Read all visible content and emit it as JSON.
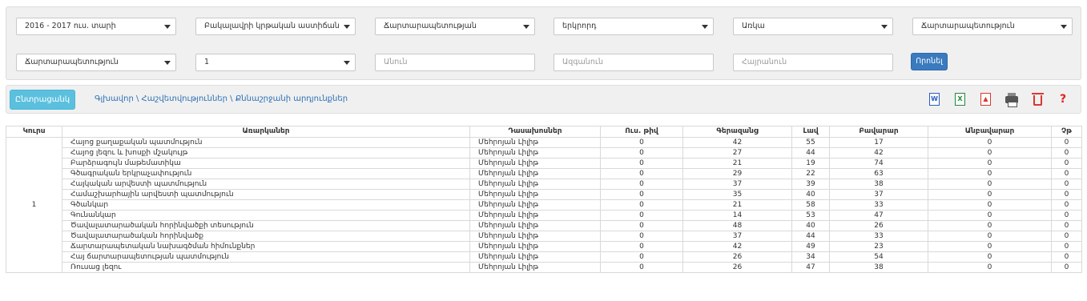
{
  "filters": {
    "row1": [
      {
        "value": "2016 - 2017 ուս. տարի",
        "type": "select"
      },
      {
        "value": "Բակալավրի կրթական աստիճան",
        "type": "select"
      },
      {
        "value": "Ճարտարապետության",
        "type": "select"
      },
      {
        "value": "երկրորդ",
        "type": "select"
      },
      {
        "value": "Առկա",
        "type": "select"
      },
      {
        "value": "Ճարտարապետություն",
        "type": "select"
      }
    ],
    "row2": [
      {
        "value": "Ճարտարապետություն",
        "type": "select"
      },
      {
        "value": "1",
        "type": "select"
      },
      {
        "placeholder": "Անուն",
        "type": "input"
      },
      {
        "placeholder": "Ազգանուն",
        "type": "input"
      },
      {
        "placeholder": "Հայրանուն",
        "type": "input"
      }
    ],
    "search_label": "Որոնել"
  },
  "toolbar": {
    "menu_label": "Ընտրացանկ",
    "breadcrumb": "Գլխավոր \\ Հաշվետվություններ \\ Քննաշրջանի արդյունքներ",
    "icons": [
      "word-icon",
      "excel-icon",
      "pdf-icon",
      "print-icon",
      "trash-icon",
      "help-icon"
    ]
  },
  "table": {
    "headers": [
      "Կուրս",
      "Առարկաներ",
      "Դասախոսներ",
      "Ուս. թիվ",
      "Գերազանց",
      "Լավ",
      "Բավարար",
      "Անբավարար",
      "Չթ"
    ],
    "course": "1",
    "rows": [
      [
        "Հայոց քաղաքական պատմություն",
        "Մեհրոյան Լիլիթ",
        "0",
        "42",
        "55",
        "17",
        "0",
        "0"
      ],
      [
        "Հայոց լեզու և խոսքի մշակույթ",
        "Մեհրոյան Լիլիթ",
        "0",
        "27",
        "44",
        "42",
        "0",
        "0"
      ],
      [
        "Բարձրագույն մաթեմատիկա",
        "Մեհրոյան Լիլիթ",
        "0",
        "21",
        "19",
        "74",
        "0",
        "0"
      ],
      [
        "Գծագրական երկրաչափություն",
        "Մեհրոյան Լիլիթ",
        "0",
        "29",
        "22",
        "63",
        "0",
        "0"
      ],
      [
        "Հայկական արվեստի պատմություն",
        "Մեհրոյան Լիլիթ",
        "0",
        "37",
        "39",
        "38",
        "0",
        "0"
      ],
      [
        "Համաշխարհային արվեստի պատմություն",
        "Մեհրոյան Լիլիթ",
        "0",
        "35",
        "40",
        "37",
        "0",
        "0"
      ],
      [
        "Գծանկար",
        "Մեհրոյան Լիլիթ",
        "0",
        "21",
        "58",
        "33",
        "0",
        "0"
      ],
      [
        "Գունանկար",
        "Մեհրոյան Լիլիթ",
        "0",
        "14",
        "53",
        "47",
        "0",
        "0"
      ],
      [
        "Ծավալատարածական հորինվածքի տեսություն",
        "Մեհրոյան Լիլիթ",
        "0",
        "48",
        "40",
        "26",
        "0",
        "0"
      ],
      [
        "Ծավալատարածական հորինվածք",
        "Մեհրոյան Լիլիթ",
        "0",
        "37",
        "44",
        "33",
        "0",
        "0"
      ],
      [
        "Ճարտարապետական նախագծման հիմունքներ",
        "Մեհրոյան Լիլիթ",
        "0",
        "42",
        "49",
        "23",
        "0",
        "0"
      ],
      [
        "Հայ ճարտարապետության պատմություն",
        "Մեհրոյան Լիլիթ",
        "0",
        "26",
        "34",
        "54",
        "0",
        "0"
      ],
      [
        "Ռուսաց լեզու",
        "Մեհրոյան Լիլիթ",
        "0",
        "26",
        "47",
        "38",
        "0",
        "0"
      ]
    ]
  }
}
